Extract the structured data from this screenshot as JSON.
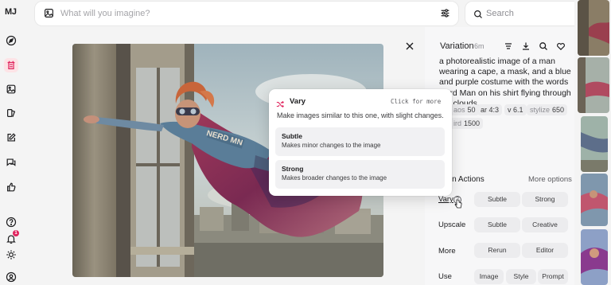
{
  "brand": {
    "logo": "MJ"
  },
  "colors": {
    "accent": "#e0245e",
    "tooltip_bg": "#ffffff",
    "chip_bg": "#ececee"
  },
  "sidebar": {
    "items": [
      {
        "icon": "compass-icon"
      },
      {
        "icon": "create-icon"
      },
      {
        "icon": "gallery-icon"
      },
      {
        "icon": "organize-icon"
      },
      {
        "icon": "edit-icon"
      },
      {
        "icon": "chat-icon"
      },
      {
        "icon": "likes-icon"
      }
    ],
    "bottom": [
      {
        "icon": "help-icon"
      },
      {
        "icon": "bell-icon",
        "badge": "1"
      },
      {
        "icon": "sun-icon"
      },
      {
        "icon": "profile-icon"
      }
    ]
  },
  "topbar": {
    "prompt_placeholder": "What will you imagine?",
    "search_placeholder": "Search"
  },
  "details": {
    "title": "Variation",
    "age": "6m",
    "prompt": "a photorealistic image of a man wearing a cape, a mask, and a blue and purple costume with the words Nerd Man on his shirt flying through the clouds.",
    "params": [
      {
        "key": "aspect",
        "value": "ar 4:3"
      },
      {
        "key": "version",
        "value": "v 6.1"
      },
      {
        "key": "stylize",
        "value": "650"
      }
    ],
    "param_partials": {
      "chaos_value": "50",
      "weird_value": "1500",
      "chaos_key": "aos",
      "weird_key": "ird"
    }
  },
  "actions": {
    "section_title": "Variation Actions",
    "section_title_visible": "ation Actions",
    "more_options": "More options",
    "rows": [
      {
        "label": "Vary",
        "buttons": [
          "Subtle",
          "Strong"
        ]
      },
      {
        "label": "Upscale",
        "buttons": [
          "Subtle",
          "Creative"
        ]
      },
      {
        "label": "More",
        "buttons": [
          "Rerun",
          "Editor"
        ]
      },
      {
        "label": "Use",
        "buttons": [
          "Image",
          "Style",
          "Prompt"
        ]
      }
    ]
  },
  "tooltip": {
    "title": "Vary",
    "hint": "Click for more",
    "description": "Make images similar to this one, with slight changes.",
    "options": [
      {
        "title": "Subtle",
        "description": "Makes minor changes to the image"
      },
      {
        "title": "Strong",
        "description": "Makes broader changes to the image"
      }
    ]
  },
  "image": {
    "shirt_text": "NERD MN"
  }
}
